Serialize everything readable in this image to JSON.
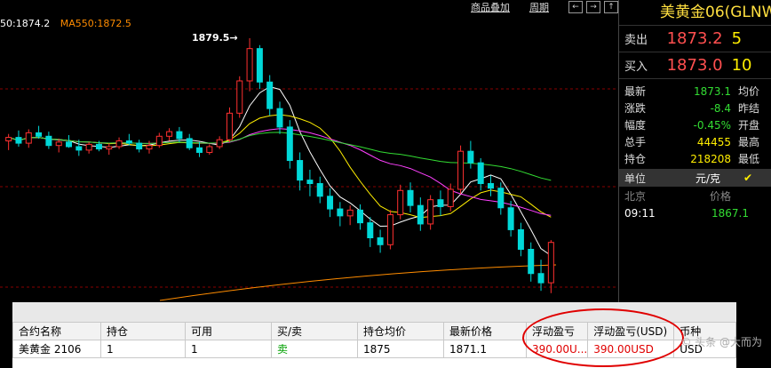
{
  "chart": {
    "ma_legend": [
      {
        "text": "50:1874.2",
        "color": "#ffffff"
      },
      {
        "text": "MA550:1872.5",
        "color": "#ff8c00"
      }
    ],
    "peak_label": "1879.5",
    "toolbar": {
      "overlay": "商品叠加",
      "period": "周期"
    },
    "candles": [
      [
        1870.6,
        1871.2,
        1869.8,
        1870.9
      ],
      [
        1870.9,
        1871.5,
        1870.1,
        1870.4
      ],
      [
        1870.4,
        1871.6,
        1870.0,
        1871.3
      ],
      [
        1871.3,
        1871.9,
        1870.8,
        1871.0
      ],
      [
        1871.0,
        1871.4,
        1869.9,
        1870.2
      ],
      [
        1870.2,
        1870.8,
        1869.6,
        1870.5
      ],
      [
        1870.5,
        1871.1,
        1870.0,
        1870.1
      ],
      [
        1870.1,
        1870.7,
        1869.3,
        1869.8
      ],
      [
        1869.8,
        1870.5,
        1869.5,
        1870.3
      ],
      [
        1870.3,
        1870.6,
        1869.7,
        1869.9
      ],
      [
        1869.9,
        1870.4,
        1869.4,
        1870.1
      ],
      [
        1870.1,
        1870.9,
        1869.9,
        1870.6
      ],
      [
        1870.6,
        1871.2,
        1870.2,
        1870.4
      ],
      [
        1870.4,
        1870.7,
        1869.6,
        1869.9
      ],
      [
        1869.9,
        1870.6,
        1869.5,
        1870.2
      ],
      [
        1870.2,
        1871.3,
        1870.0,
        1871.0
      ],
      [
        1871.0,
        1871.7,
        1870.6,
        1871.4
      ],
      [
        1871.4,
        1871.8,
        1870.5,
        1870.8
      ],
      [
        1870.8,
        1871.2,
        1869.8,
        1870.0
      ],
      [
        1870.0,
        1870.5,
        1869.2,
        1869.6
      ],
      [
        1869.6,
        1870.3,
        1869.4,
        1870.1
      ],
      [
        1870.1,
        1871.0,
        1869.9,
        1870.7
      ],
      [
        1870.7,
        1873.5,
        1870.5,
        1873.0
      ],
      [
        1873.0,
        1876.2,
        1872.6,
        1875.8
      ],
      [
        1875.8,
        1879.5,
        1874.9,
        1878.6
      ],
      [
        1878.6,
        1878.9,
        1875.1,
        1875.7
      ],
      [
        1875.7,
        1876.3,
        1872.8,
        1873.4
      ],
      [
        1873.4,
        1874.0,
        1871.2,
        1871.8
      ],
      [
        1871.8,
        1872.4,
        1868.2,
        1868.9
      ],
      [
        1868.9,
        1869.6,
        1866.3,
        1867.2
      ],
      [
        1867.2,
        1868.1,
        1865.8,
        1866.9
      ],
      [
        1866.9,
        1867.5,
        1865.2,
        1865.8
      ],
      [
        1865.8,
        1866.5,
        1864.0,
        1864.7
      ],
      [
        1864.7,
        1865.3,
        1863.2,
        1864.1
      ],
      [
        1864.1,
        1865.0,
        1863.3,
        1864.6
      ],
      [
        1864.6,
        1865.1,
        1862.9,
        1863.5
      ],
      [
        1863.5,
        1864.0,
        1861.4,
        1862.2
      ],
      [
        1862.2,
        1862.9,
        1860.9,
        1861.6
      ],
      [
        1861.6,
        1864.6,
        1861.2,
        1864.2
      ],
      [
        1864.2,
        1866.8,
        1863.8,
        1866.3
      ],
      [
        1866.3,
        1867.0,
        1864.4,
        1865.0
      ],
      [
        1865.0,
        1865.7,
        1862.8,
        1863.4
      ],
      [
        1863.4,
        1865.9,
        1862.9,
        1865.5
      ],
      [
        1865.5,
        1866.3,
        1864.1,
        1864.9
      ],
      [
        1864.9,
        1866.9,
        1864.5,
        1866.4
      ],
      [
        1866.4,
        1870.2,
        1866.0,
        1869.7
      ],
      [
        1869.7,
        1870.6,
        1868.2,
        1868.7
      ],
      [
        1868.7,
        1869.1,
        1866.3,
        1866.9
      ],
      [
        1866.9,
        1867.6,
        1865.8,
        1866.5
      ],
      [
        1866.5,
        1867.0,
        1864.2,
        1864.8
      ],
      [
        1864.8,
        1865.4,
        1862.3,
        1862.9
      ],
      [
        1862.9,
        1863.5,
        1860.6,
        1861.2
      ],
      [
        1861.2,
        1861.8,
        1858.4,
        1859.1
      ],
      [
        1859.1,
        1860.3,
        1857.6,
        1858.3
      ],
      [
        1858.3,
        1862.0,
        1857.4,
        1861.8
      ]
    ]
  },
  "quote": {
    "title": "美黄金06(GLNW",
    "sell": {
      "label": "卖出",
      "price": "1873.2",
      "volume": "5"
    },
    "buy": {
      "label": "买入",
      "price": "1873.0",
      "volume": "10"
    },
    "rows": [
      {
        "label": "最新",
        "value": "1873.1",
        "color": "green",
        "label2": "均价"
      },
      {
        "label": "涨跌",
        "value": "-8.4",
        "color": "green",
        "label2": "昨结"
      },
      {
        "label": "幅度",
        "value": "-0.45%",
        "color": "green",
        "label2": "开盘"
      },
      {
        "label": "总手",
        "value": "44455",
        "color": "yellow",
        "label2": "最高"
      },
      {
        "label": "持仓",
        "value": "218208",
        "color": "yellow",
        "label2": "最低"
      }
    ],
    "unit": {
      "label": "单位",
      "value": "元/克",
      "check": "✔"
    },
    "tick_head": {
      "location": "北京",
      "price": "价格"
    },
    "tick": {
      "time": "09:11",
      "price": "1867.1"
    }
  },
  "positions": {
    "headers": [
      "合约名称",
      "持仓",
      "可用",
      "买/卖",
      "持仓均价",
      "最新价格",
      "浮动盈亏",
      "浮动盈亏(USD)",
      "币种"
    ],
    "row": [
      "美黄金 2106",
      "1",
      "1",
      "卖",
      "1875",
      "1871.1",
      "390.00U...",
      "390.00USD",
      "USD"
    ]
  },
  "watermark": "© 头条 @大而为"
}
